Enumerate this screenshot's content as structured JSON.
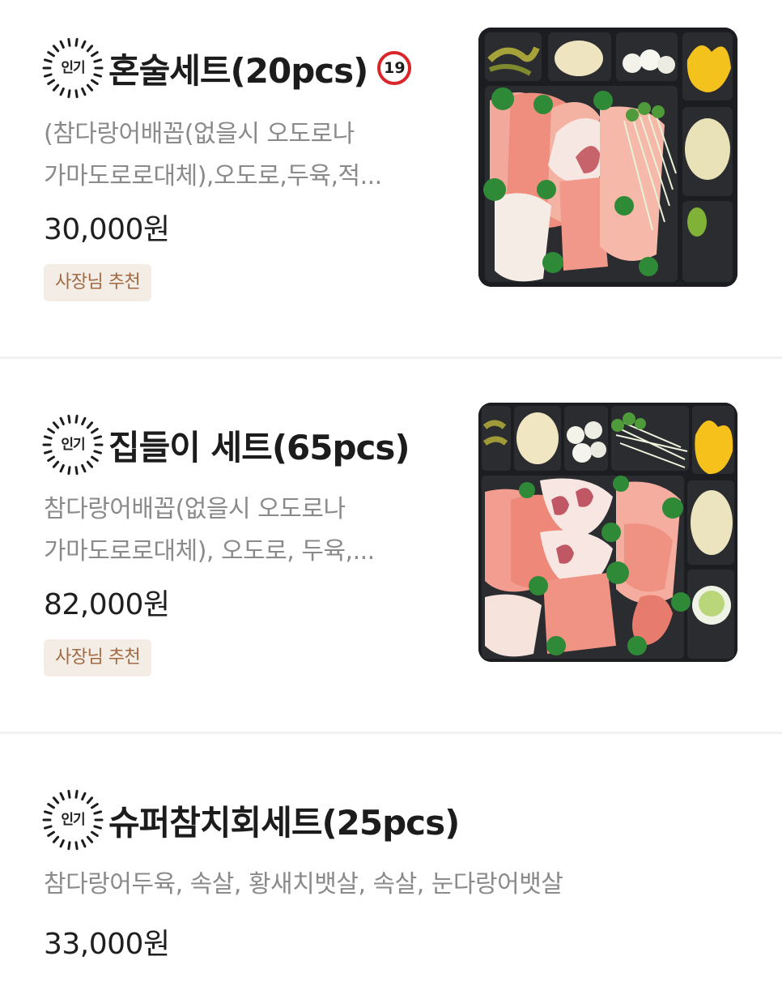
{
  "popular_badge_label": "인기",
  "recommend_tag": "사장님 추천",
  "items": [
    {
      "title": "혼술세트(20pcs)",
      "age_badge": "19",
      "desc_line1": "(참다랑어배꼽(없을시 오도로나",
      "desc_line2": "가마도로로대체),오도로,두육,적...",
      "price": "30,000원",
      "image_icon": "tuna-sashimi-platter-image"
    },
    {
      "title": "집들이 세트(65pcs)",
      "desc_line1": "참다랑어배꼽(없을시 오도로나",
      "desc_line2": "가마도로로대체), 오도로, 두육,...",
      "price": "82,000원",
      "image_icon": "tuna-sashimi-large-platter-image"
    },
    {
      "title": "슈퍼참치회세트(25pcs)",
      "desc_line1": "참다랑어두육, 속살, 황새치뱃살, 속살, 눈다랑어뱃살",
      "price": "33,000원"
    }
  ],
  "colors": {
    "age_badge_ring": "#d8262a",
    "tag_bg": "#f3ede6",
    "tag_text": "#a16a44",
    "desc_text": "#8a8a8a"
  }
}
